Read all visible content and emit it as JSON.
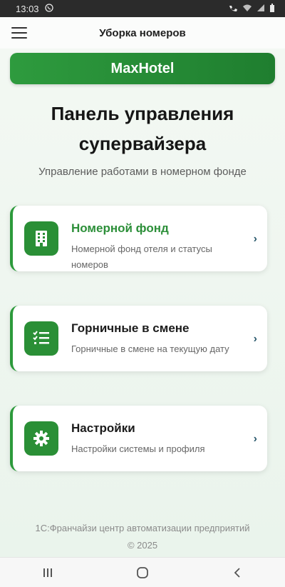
{
  "status_bar": {
    "time": "13:03"
  },
  "app_bar": {
    "title": "Уборка номеров"
  },
  "brand": {
    "name": "MaxHotel"
  },
  "heading": {
    "line1": "Панель управления",
    "line2": "супервайзера"
  },
  "subtitle": "Управление работами в номерном фонде",
  "cards": [
    {
      "title": "Номерной фонд",
      "description": "Номерной фонд отеля и статусы номеров",
      "icon": "building-icon"
    },
    {
      "title": "Горничные в смене",
      "description": "Горничные в смене на текущую дату",
      "icon": "checklist-icon"
    },
    {
      "title": "Настройки",
      "description": "Настройки системы и профиля",
      "icon": "gear-icon"
    }
  ],
  "footer": {
    "company": "1С:Франчайзи центр автоматизации предприятий",
    "copyright": "© 2025"
  },
  "colors": {
    "accent": "#2c9a3b",
    "brand_bar": "#1f7e2f"
  }
}
